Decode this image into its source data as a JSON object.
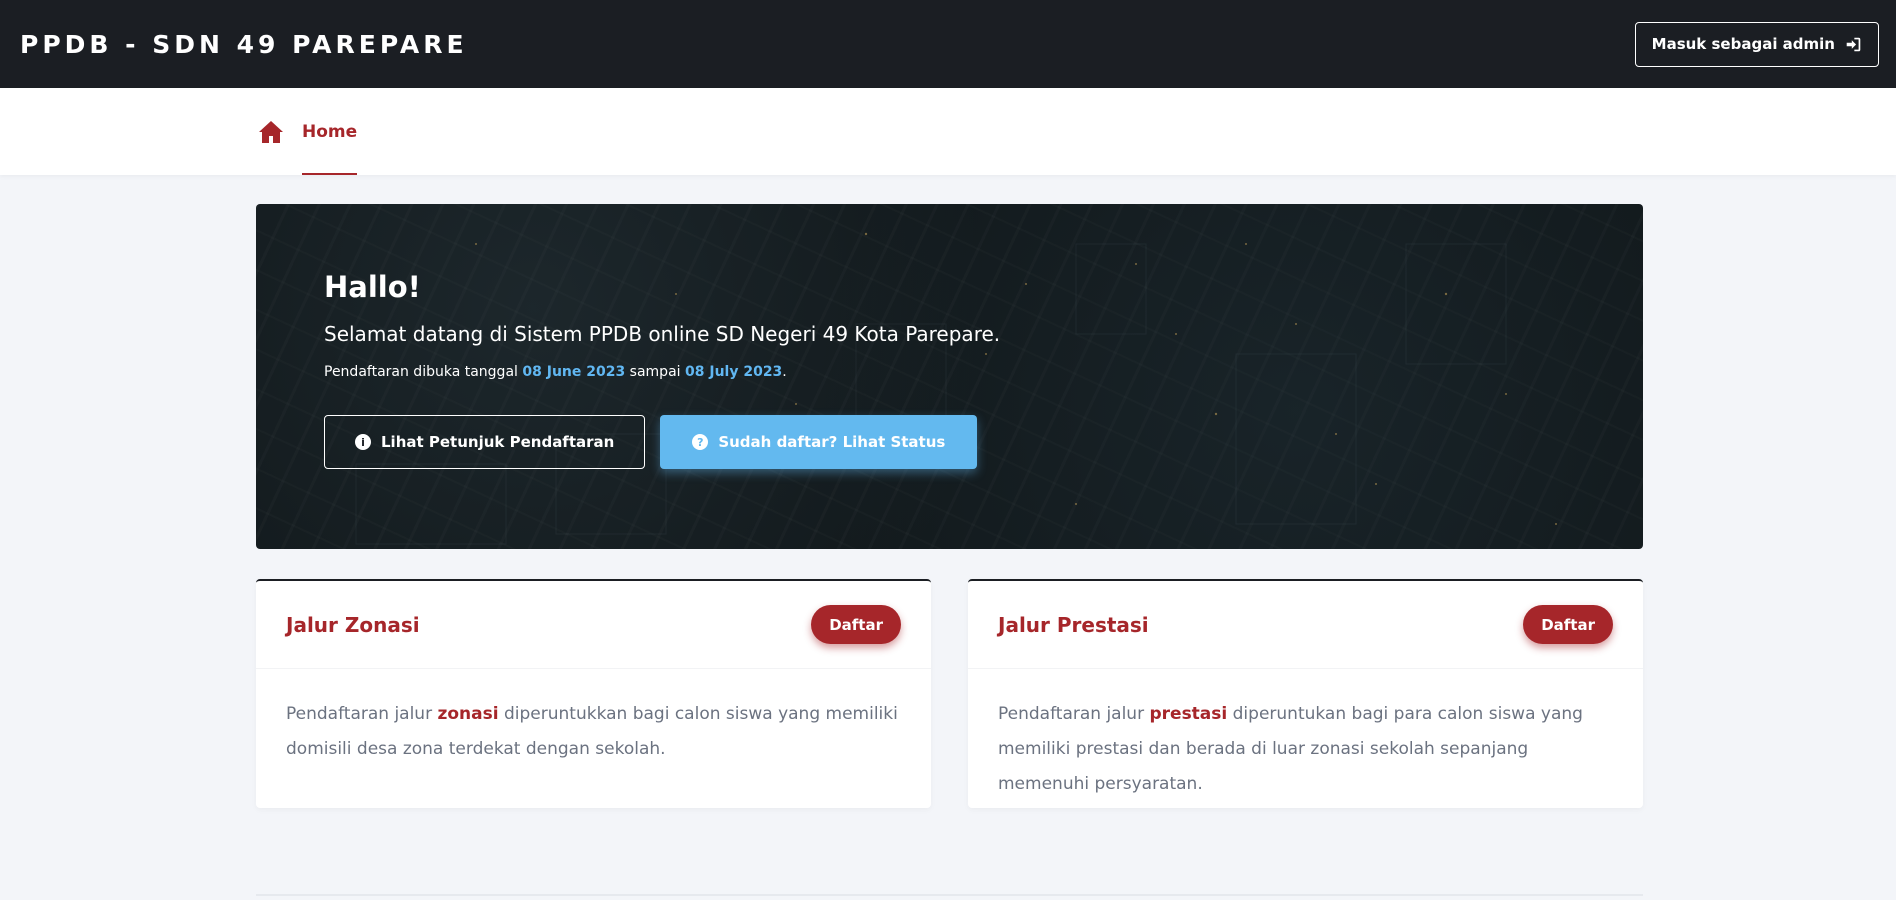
{
  "header": {
    "brand": "PPDB - SDN 49 PAREPARE",
    "admin_button": "Masuk sebagai admin"
  },
  "nav": {
    "home_label": "Home"
  },
  "hero": {
    "title": "Hallo!",
    "welcome": "Selamat datang di Sistem PPDB online SD Negeri 49 Kota Parepare.",
    "date_prefix": "Pendaftaran dibuka tanggal",
    "date_start": "08 June 2023",
    "date_mid": "sampai",
    "date_end": "08 July 2023",
    "date_suffix": ".",
    "guide_button": "Lihat Petunjuk Pendaftaran",
    "status_button": "Sudah daftar? Lihat Status"
  },
  "cards": [
    {
      "title": "Jalur Zonasi",
      "button": "Daftar",
      "text_before": "Pendaftaran jalur",
      "highlight": "zonasi",
      "text_after": "diperuntukkan bagi calon siswa yang memiliki domisili desa zona terdekat dengan sekolah."
    },
    {
      "title": "Jalur Prestasi",
      "button": "Daftar",
      "text_before": "Pendaftaran jalur",
      "highlight": "prestasi",
      "text_after": "diperuntukan bagi para calon siswa yang memiliki prestasi dan berada di luar zonasi sekolah sepanjang memenuhi persyaratan."
    }
  ],
  "colors": {
    "topbar": "#1b1e23",
    "accent": "#a6262a",
    "info": "#63b9ef"
  },
  "icons": {
    "admin": "sign-in-icon",
    "home": "home-icon",
    "guide": "info-circle-icon",
    "status": "question-circle-icon"
  }
}
